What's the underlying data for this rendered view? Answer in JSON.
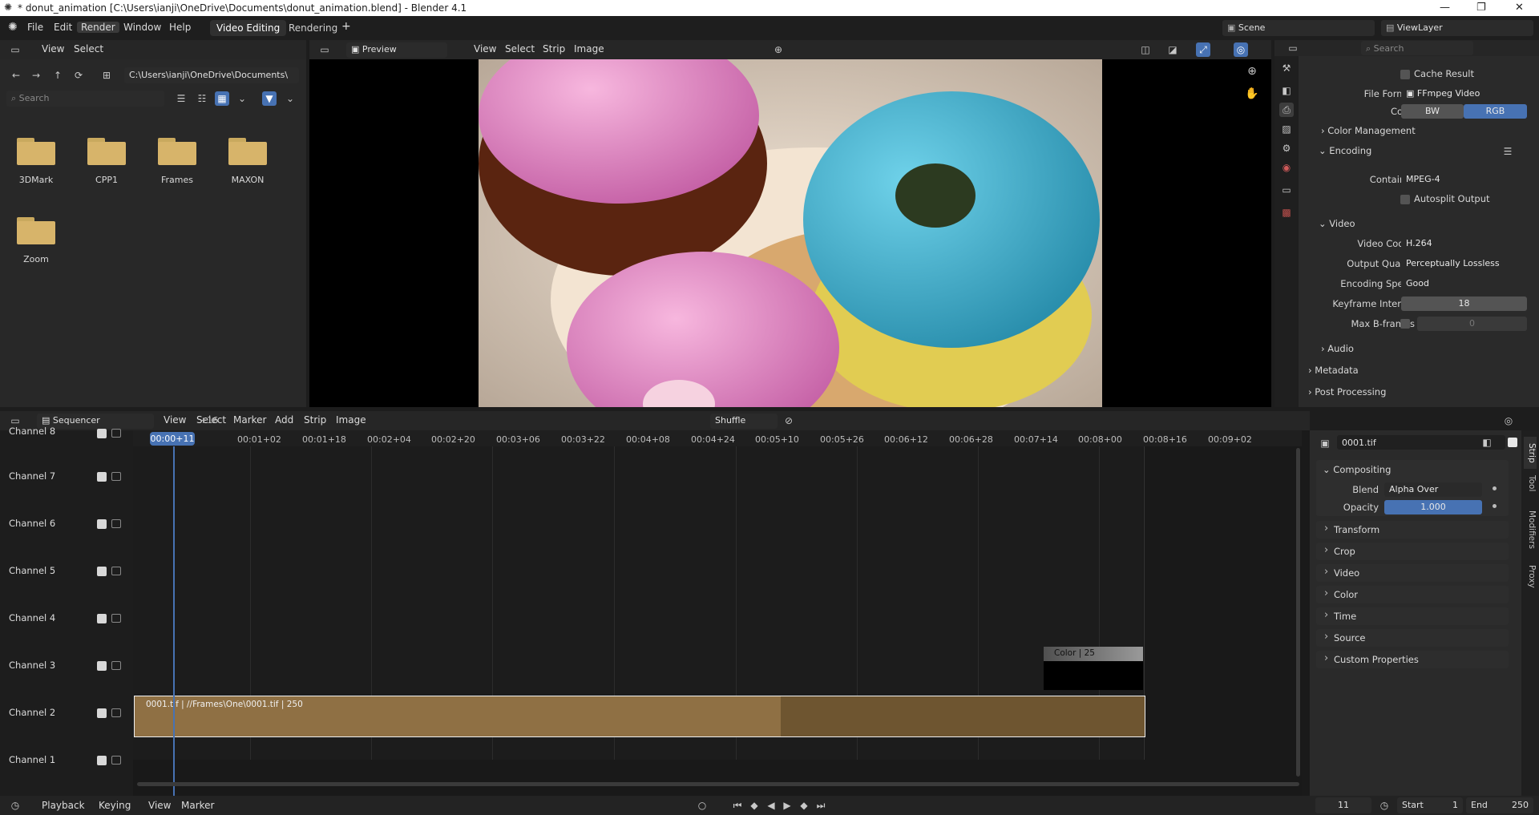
{
  "window": {
    "title": "* donut_animation [C:\\Users\\ianji\\OneDrive\\Documents\\donut_animation.blend] - Blender 4.1"
  },
  "topbar": {
    "menus": [
      "File",
      "Edit",
      "Render",
      "Window",
      "Help"
    ],
    "tabs": [
      "Video Editing",
      "Rendering"
    ],
    "add_tab": "+",
    "scene": "Scene",
    "view_layer": "ViewLayer"
  },
  "filebrowser": {
    "menus": [
      "View",
      "Select"
    ],
    "path": "C:\\Users\\ianji\\OneDrive\\Documents\\",
    "search_placeholder": "Search",
    "folders": [
      "3DMark",
      "CPP1",
      "Frames",
      "MAXON",
      "Zoom"
    ]
  },
  "preview": {
    "mode": "Preview",
    "menus": [
      "View",
      "Select",
      "Strip",
      "Image"
    ]
  },
  "properties": {
    "search_placeholder": "Search",
    "cache_result": "Cache Result",
    "file_format_label": "File Format",
    "file_format": "FFmpeg Video",
    "color_label": "Color",
    "color_bw": "BW",
    "color_rgb": "RGB",
    "color_management": "Color Management",
    "encoding": "Encoding",
    "container_label": "Container",
    "container": "MPEG-4",
    "autosplit": "Autosplit Output",
    "video": "Video",
    "video_codec_label": "Video Codec",
    "video_codec": "H.264",
    "output_quality_label": "Output Quality",
    "output_quality": "Perceptually Lossless",
    "encoding_speed_label": "Encoding Speed",
    "encoding_speed": "Good",
    "keyframe_label": "Keyframe Interval",
    "keyframe": "18",
    "bframes_label": "Max B-frames",
    "bframes": "0",
    "audio": "Audio",
    "metadata": "Metadata",
    "post_processing": "Post Processing"
  },
  "sequencer": {
    "editor": "Sequencer",
    "menus": [
      "View",
      "Select",
      "Marker",
      "Add",
      "Strip",
      "Image"
    ],
    "overlap_mode": "Shuffle",
    "current_time": "00:00+11",
    "ticks": [
      "+16",
      "00:01+02",
      "00:01+18",
      "00:02+04",
      "00:02+20",
      "00:03+06",
      "00:03+22",
      "00:04+08",
      "00:04+24",
      "00:05+10",
      "00:05+26",
      "00:06+12",
      "00:06+28",
      "00:07+14",
      "00:08+00",
      "00:08+16",
      "00:09+02"
    ],
    "channels": [
      "Channel 8",
      "Channel 7",
      "Channel 6",
      "Channel 5",
      "Channel 4",
      "Channel 3",
      "Channel 2",
      "Channel 1"
    ],
    "strip_image": "0001.tif | //Frames\\One\\0001.tif | 250",
    "strip_color": "Color | 25"
  },
  "strip_panel": {
    "name": "0001.tif",
    "compositing": "Compositing",
    "blend_label": "Blend",
    "blend": "Alpha Over",
    "opacity_label": "Opacity",
    "opacity": "1.000",
    "sections": [
      "Transform",
      "Crop",
      "Video",
      "Color",
      "Time",
      "Source",
      "Custom Properties"
    ],
    "side_tabs": [
      "Strip",
      "Tool",
      "Modifiers",
      "Proxy"
    ]
  },
  "statusbar": {
    "menus": [
      "Playback",
      "Keying",
      "View",
      "Marker"
    ],
    "frame": "11",
    "start_label": "Start",
    "start": "1",
    "end_label": "End",
    "end": "250"
  },
  "colors": {
    "accent": "#4772b3",
    "strip_image": "#8f7044",
    "strip_color_box": "#000000"
  }
}
